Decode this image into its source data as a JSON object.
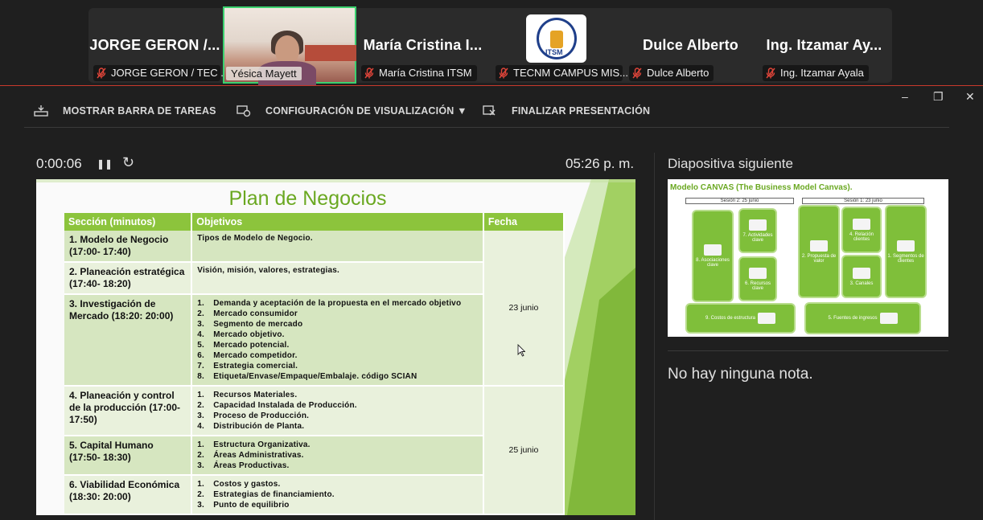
{
  "participants": [
    {
      "display": "JORGE GERON /...",
      "label": "JORGE GERON / TEC ...",
      "muted": true
    },
    {
      "display": "",
      "label": "Yésica Mayett",
      "muted": false,
      "video": true
    },
    {
      "display": "María Cristina I...",
      "label": "María Cristina ITSM",
      "muted": true
    },
    {
      "display": "",
      "label": "TECNM CAMPUS MIS...",
      "muted": true,
      "logo_text": "ITSM"
    },
    {
      "display": "Dulce Alberto",
      "label": "Dulce Alberto",
      "muted": true
    },
    {
      "display": "Ing. Itzamar Ay...",
      "label": "Ing. Itzamar Ayala",
      "muted": true
    }
  ],
  "toolbar": {
    "taskbar": "MOSTRAR BARRA DE TAREAS",
    "display_settings": "CONFIGURACIÓN DE VISUALIZACIÓN ▼",
    "end": "FINALIZAR PRESENTACIÓN"
  },
  "window_controls": {
    "minimize": "–",
    "restore": "❐",
    "close": "✕"
  },
  "presenter": {
    "timer": "0:00:06",
    "pause": "❚❚",
    "reset": "↻",
    "clock": "05:26 p. m."
  },
  "slide": {
    "title": "Plan de Negocios",
    "headers": [
      "Sección (minutos)",
      "Objetivos",
      "Fecha"
    ],
    "rows": [
      {
        "section": "1. Modelo de Negocio (17:00- 17:40)",
        "objectives": [
          "Tipos de Modelo de Negocio."
        ],
        "numbered": false
      },
      {
        "section": "2. Planeación estratégica (17:40- 18:20)",
        "objectives": [
          "Visión, misión, valores, estrategias."
        ],
        "numbered": false
      },
      {
        "section": "3. Investigación de Mercado (18:20: 20:00)",
        "numbered": true,
        "objectives": [
          "Demanda y aceptación de la propuesta en el mercado objetivo",
          "Mercado consumidor",
          "Segmento de mercado",
          "Mercado objetivo.",
          "Mercado potencial.",
          "Mercado competidor.",
          "Estrategia comercial.",
          "Etiqueta/Envase/Empaque/Embalaje. código SCIAN"
        ]
      },
      {
        "section": "4. Planeación y control de la producción (17:00- 17:50)",
        "numbered": true,
        "objectives": [
          "Recursos Materiales.",
          "Capacidad Instalada de Producción.",
          "Proceso de Producción.",
          "Distribución de Planta."
        ]
      },
      {
        "section": "5. Capital Humano (17:50- 18:30)",
        "numbered": true,
        "objectives": [
          "Estructura Organizativa.",
          "Áreas Administrativas.",
          "Áreas Productivas."
        ]
      },
      {
        "section": "6. Viabilidad Económica (18:30: 20:00)",
        "numbered": true,
        "objectives": [
          "Costos y gastos.",
          "Estrategias de financiamiento.",
          "Punto de equilibrio"
        ]
      }
    ],
    "dates": [
      "23 junio",
      "25 junio"
    ]
  },
  "next_slide": {
    "label": "Diapositiva siguiente",
    "title": "Modelo CANVAS (The Business Model Canvas).",
    "session2": "Sesión 2: 25 junio",
    "session1": "Sesión 1: 23 junio",
    "blocks": {
      "b8": "8. Asociaciones clave",
      "b7": "7. Actividades clave",
      "b6": "6. Recursos clave",
      "b2": "2. Propuesta de valor",
      "b4": "4. Relación clientes",
      "b3": "3. Canales",
      "b1": "1. Segmentos de clientes",
      "b9": "9. Costos de estructura",
      "b5": "5. Fuentes de ingresos"
    }
  },
  "notes": "No hay ninguna nota.",
  "colors": {
    "accent": "#8cc43c",
    "active_border": "#34c759",
    "muted_icon": "#e0453a"
  }
}
